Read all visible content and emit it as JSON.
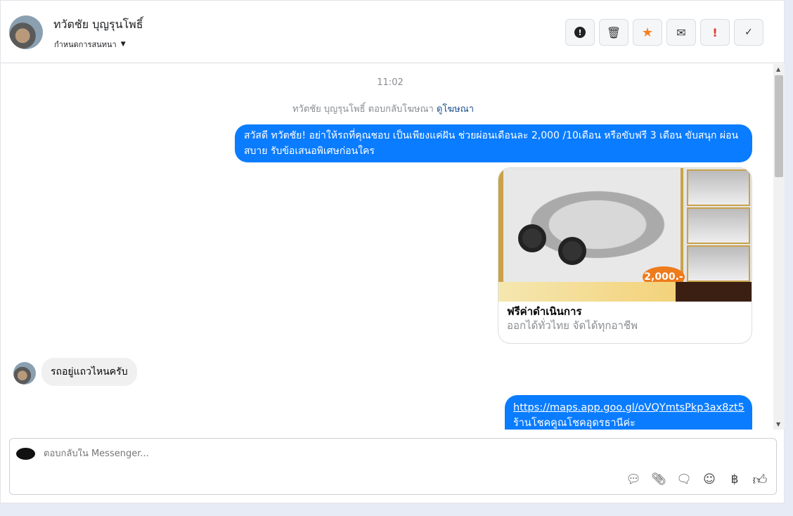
{
  "header": {
    "contact_name": "ทวัตชัย บุญรุนโพธิ์",
    "assign_label": "กำหนดการสนทนา",
    "actions": [
      {
        "icon": "alert-circle-icon"
      },
      {
        "icon": "trash-icon"
      },
      {
        "icon": "star-icon",
        "color": "#f5821f"
      },
      {
        "icon": "envelope-icon"
      },
      {
        "icon": "exclamation-icon",
        "color": "#e0382f"
      },
      {
        "icon": "checkmark-icon"
      }
    ]
  },
  "conversation": {
    "timestamp": "11:02",
    "ad_reply_note": "ทวัตชัย บุญรุนโพธิ์ ตอบกลับโฆษณา",
    "view_ad_link": "ดูโฆษณา",
    "outgoing_message_1": "สวัสดี ทวัตชัย! อย่าให้รถที่คุณชอบ เป็นเพียงแค่ฝัน ช่วยผ่อนเดือนละ 2,000 /10เดือน หรือขับฟรี 3 เดือน ขับสนุก ผ่อนสบาย รับข้อเสนอพิเศษก่อนใคร",
    "ad_card": {
      "image_price": "2,000.-",
      "title": "ฟรีค่าดำเนินการ",
      "subtitle": "ออกได้ทั่วไทย จัดได้ทุกอาชีพ"
    },
    "incoming_message": "รถอยู่แถวไหนครับ",
    "outgoing_message_2_link": "https://maps.app.goo.gl/oVQYmtsPkp3ax8zt5",
    "outgoing_message_2_text": "ร้านโชคคูณโชคอุดรธานีค่ะ"
  },
  "composer": {
    "placeholder": "ตอบกลับใน Messenger...",
    "currency_symbol": "฿"
  },
  "colors": {
    "accent": "#0a7cff"
  }
}
